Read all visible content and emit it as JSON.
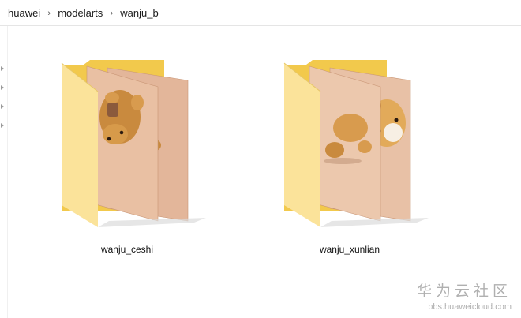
{
  "address_bar": {
    "breadcrumb": [
      "huawei",
      "modelarts",
      "wanju_b"
    ],
    "separator": "›"
  },
  "folders": [
    {
      "name": "wanju_ceshi",
      "icon": "folder-with-photo-thumbnails-icon"
    },
    {
      "name": "wanju_xunlian",
      "icon": "folder-with-photo-thumbnails-icon"
    }
  ],
  "watermark": {
    "title": "华为云社区",
    "url": "bbs.huaweicloud.com"
  },
  "colors": {
    "folder_back": "#f2c94c",
    "folder_front": "#fbe39a",
    "photo": "#e6b08f"
  }
}
